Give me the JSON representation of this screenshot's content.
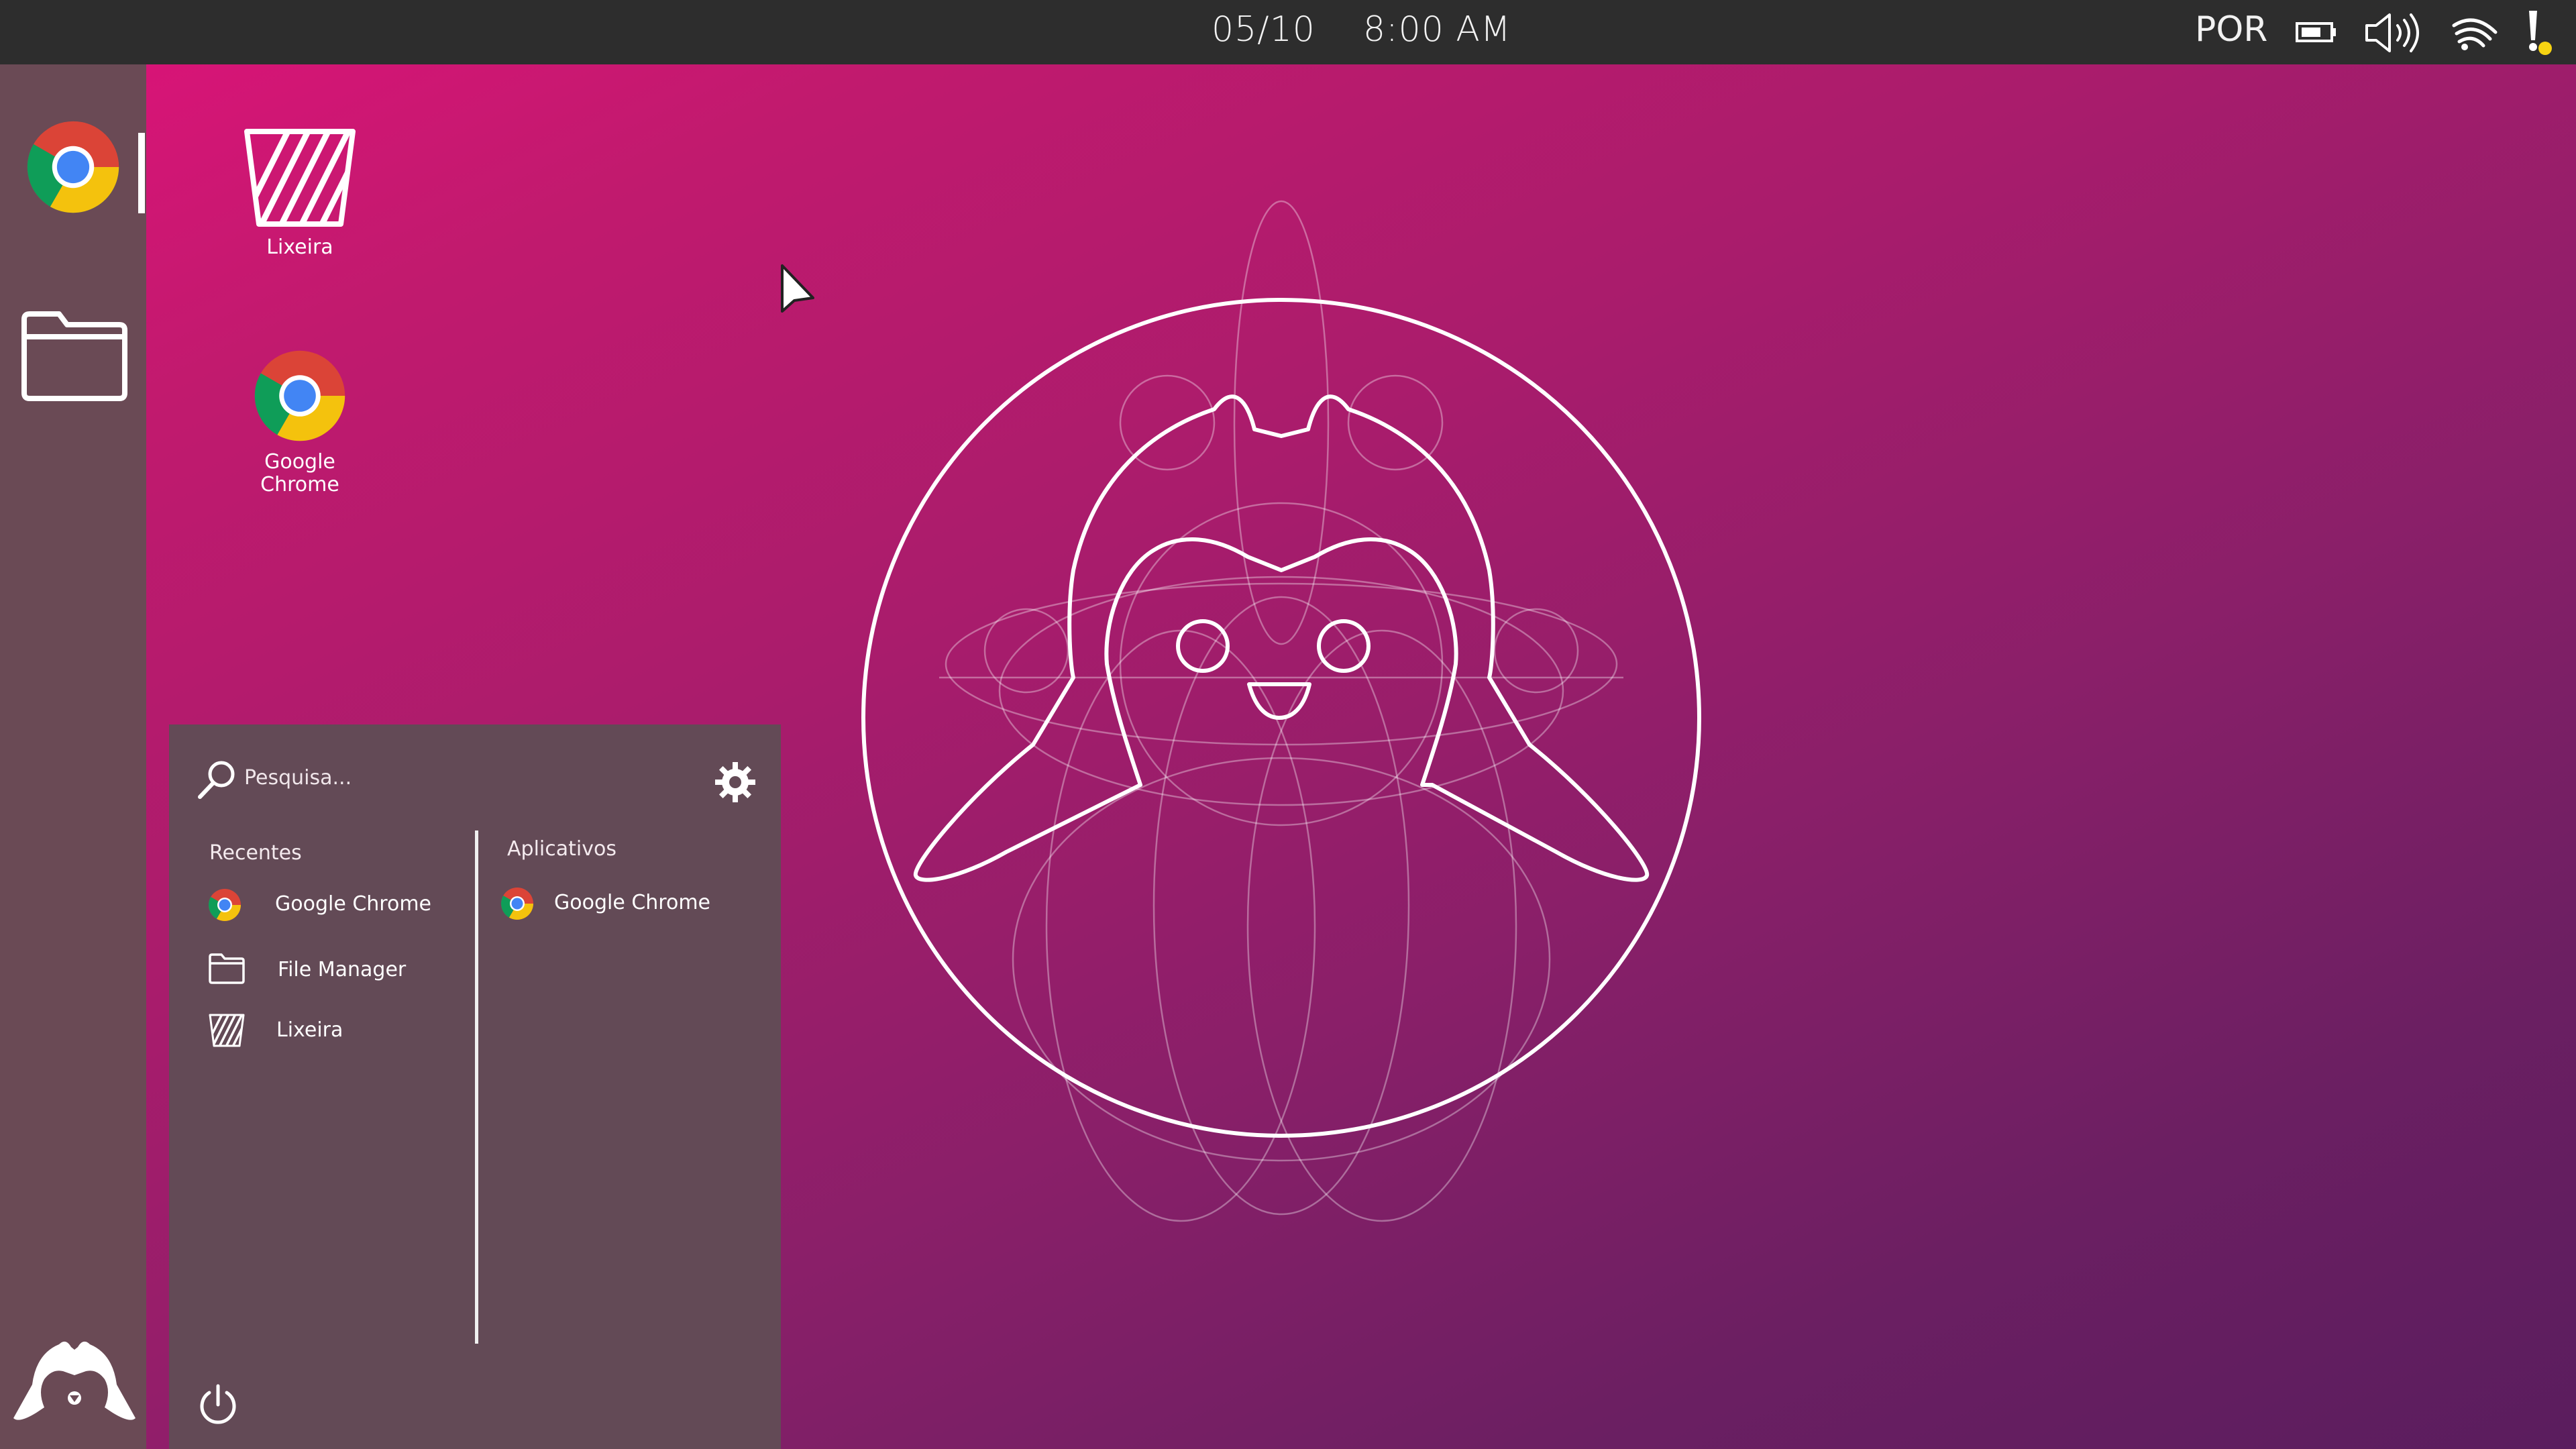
{
  "topbar": {
    "date": "05/10",
    "time": "8:00 AM",
    "language": "POR",
    "tray_icons": [
      "battery-icon",
      "volume-icon",
      "wifi-icon",
      "notification-alert-icon"
    ],
    "alert_color": "#f6d312"
  },
  "dock": {
    "items": [
      {
        "name": "Google Chrome",
        "icon": "chrome-icon",
        "active": true
      },
      {
        "name": "File Manager",
        "icon": "folder-icon",
        "active": false
      }
    ],
    "launcher_icon": "penguin-launcher-icon"
  },
  "desktop": {
    "icons": [
      {
        "label": "Lixeira",
        "icon": "trash-icon"
      },
      {
        "label": "Google\nChrome",
        "icon": "chrome-icon"
      }
    ],
    "wallpaper_colors": [
      "#e0127a",
      "#8a1f69",
      "#5a1d5e"
    ]
  },
  "menu": {
    "search_placeholder": "Pesquisa...",
    "recents_title": "Recentes",
    "recents": [
      {
        "label": "Google Chrome",
        "icon": "chrome-icon"
      },
      {
        "label": "File Manager",
        "icon": "folder-icon"
      },
      {
        "label": "Lixeira",
        "icon": "trash-icon"
      }
    ],
    "apps_title": "Aplicativos",
    "apps": [
      {
        "label": "Google Chrome",
        "icon": "chrome-icon"
      }
    ],
    "settings_icon": "gear-icon",
    "power_icon": "power-icon"
  }
}
